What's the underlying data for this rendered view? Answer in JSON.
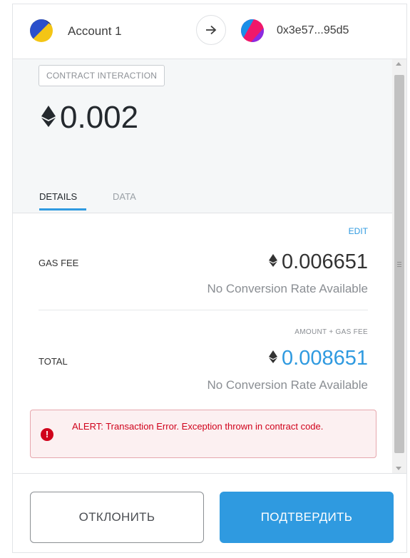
{
  "header": {
    "account_name": "Account 1",
    "recipient_address": "0x3e57...95d5"
  },
  "transaction": {
    "method_label": "CONTRACT INTERACTION",
    "amount": "0.002"
  },
  "tabs": [
    {
      "label": "DETAILS",
      "active": true
    },
    {
      "label": "DATA",
      "active": false
    }
  ],
  "details": {
    "edit_label": "EDIT",
    "gas_fee_label": "GAS FEE",
    "gas_fee_value": "0.006651",
    "gas_fee_conversion": "No Conversion Rate Available",
    "total_sublabel": "AMOUNT + GAS FEE",
    "total_label": "TOTAL",
    "total_value": "0.008651",
    "total_conversion": "No Conversion Rate Available"
  },
  "alert": {
    "text": "ALERT: Transaction Error. Exception thrown in contract code."
  },
  "footer": {
    "reject_label": "ОТКЛОНИТЬ",
    "confirm_label": "ПОДТВЕРДИТЬ"
  },
  "colors": {
    "accent": "#2f9ae0",
    "error": "#d0021b",
    "top_background": "#f5f7f8"
  },
  "icons": [
    "account-identicon",
    "arrow-right-icon",
    "recipient-identicon",
    "eth-icon",
    "alert-icon"
  ]
}
